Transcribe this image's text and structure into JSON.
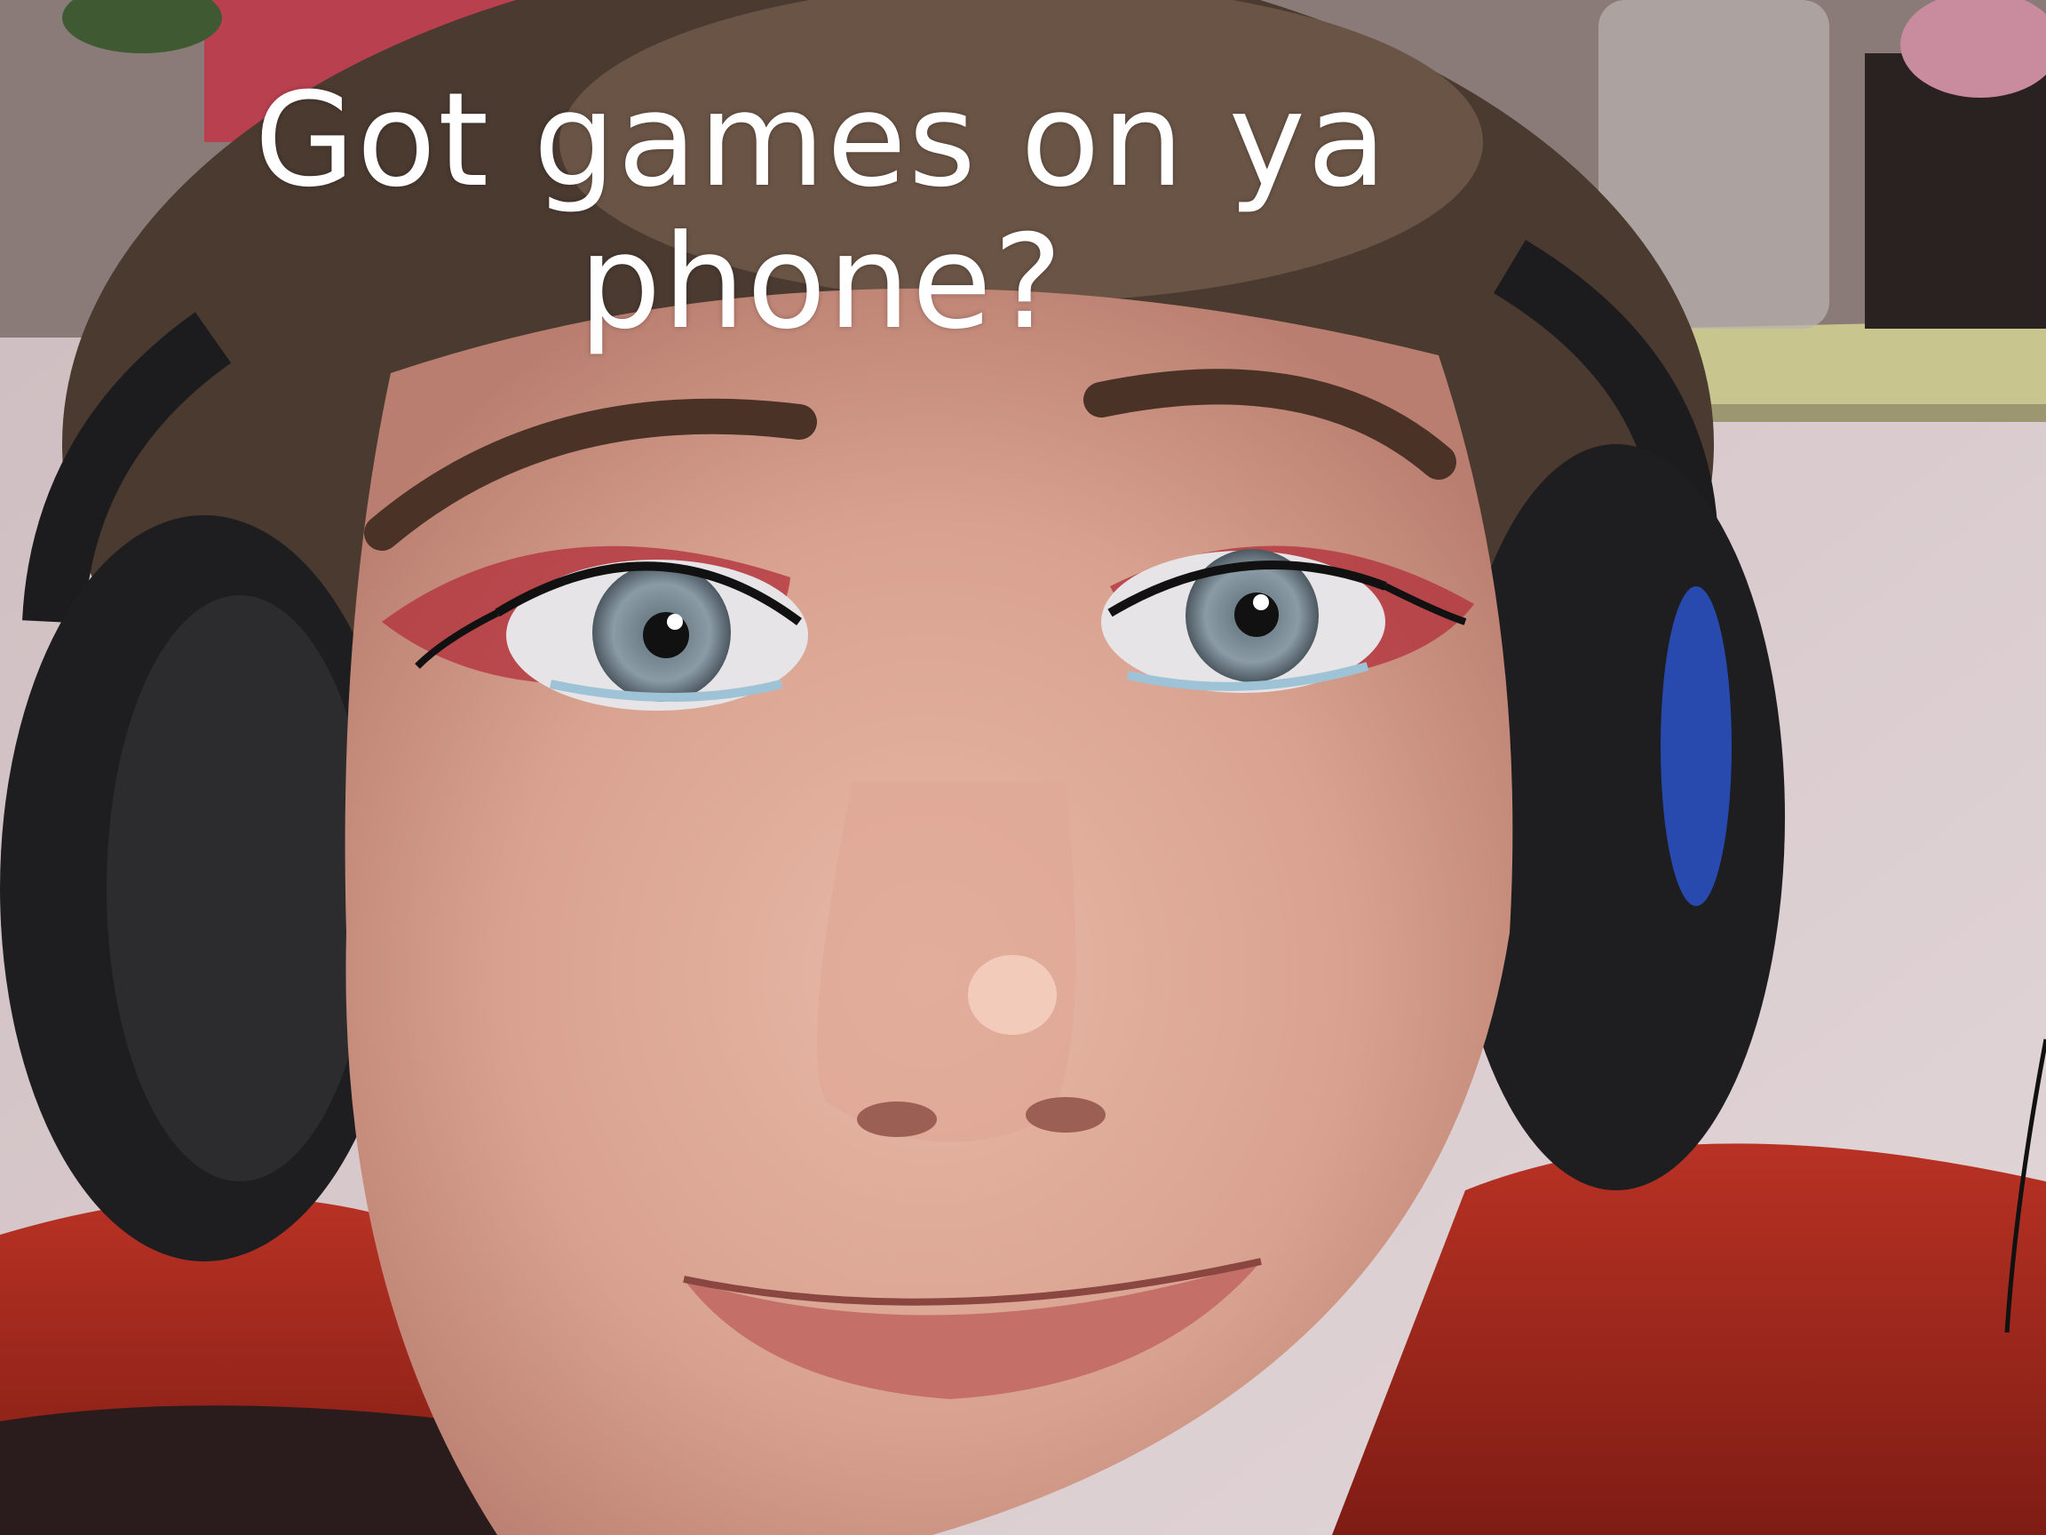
{
  "meme": {
    "caption": "Got games on ya phone?"
  },
  "colors": {
    "caption_text": "#ffffff",
    "wall": "#d8c9cc",
    "shelf": "#c9c58e",
    "skin": "#d9a89a",
    "hair": "#4a3a30",
    "headphones": "#1c1c1e",
    "headphone_accent": "#2a52c9",
    "jacket": "#b02a1e",
    "eyeshadow": "#b3343f",
    "iris": "#7c8f9c"
  }
}
